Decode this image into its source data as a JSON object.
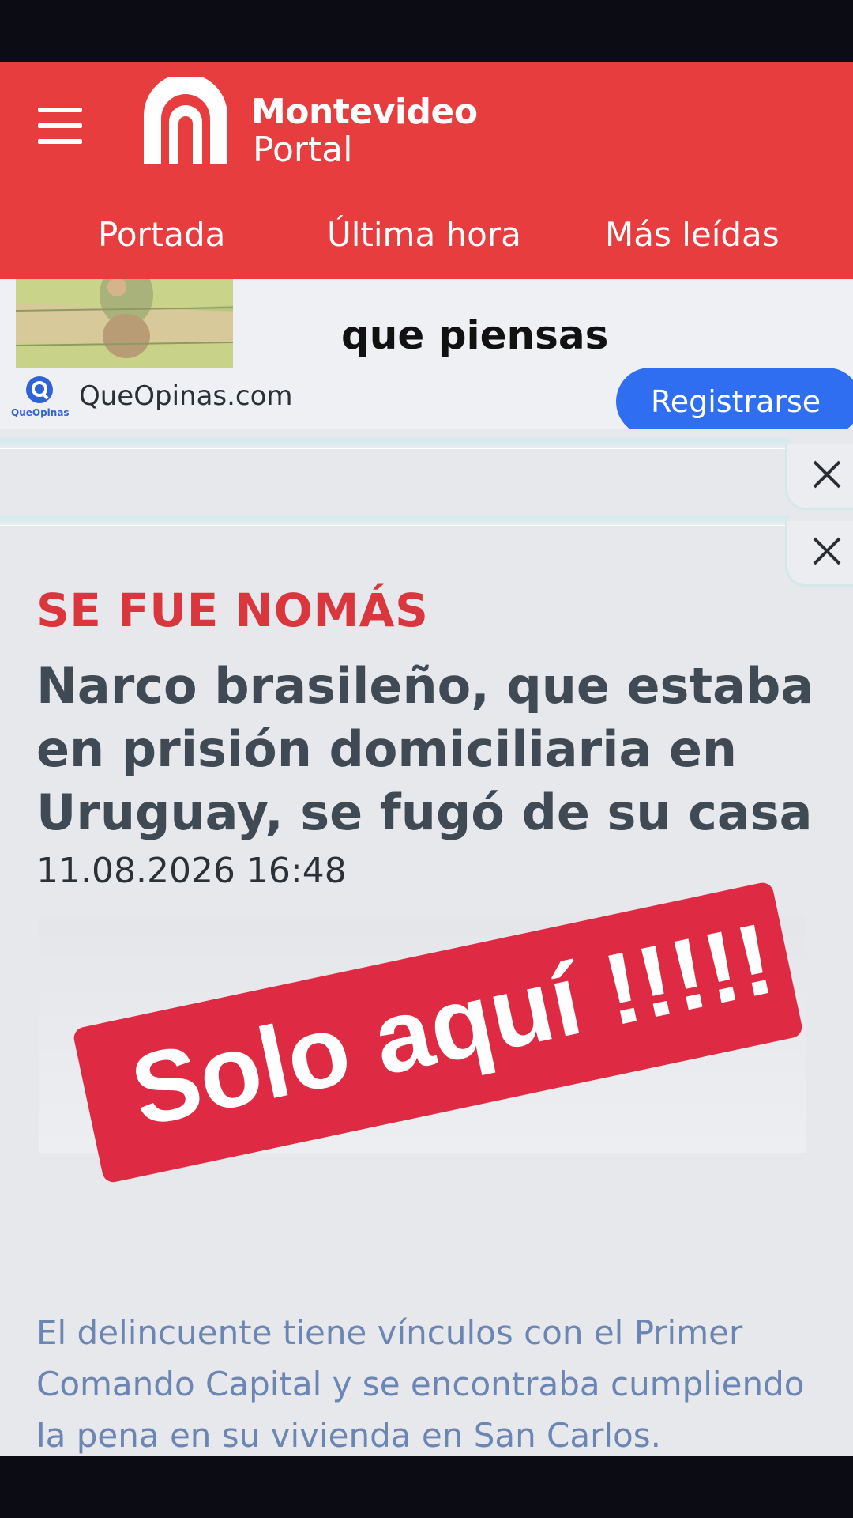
{
  "header": {
    "brand_line1": "Montevideo",
    "brand_line2": "Portal",
    "tabs": [
      {
        "label": "Portada"
      },
      {
        "label": "Última hora"
      },
      {
        "label": "Más leídas"
      }
    ],
    "accent_color": "#e83d3f"
  },
  "ad": {
    "headline": "que piensas",
    "advertiser_logo_text": "QueOpinas",
    "site": "QueOpinas.com",
    "cta_label": "Registrarse",
    "cta_color": "#2f6ef0"
  },
  "article": {
    "kicker": "SE FUE NOMÁS",
    "headline": "Narco brasileño, que estaba en prisión domiciliaria en Uruguay, se fugó de su casa",
    "timestamp": "11.08.2026 16:48",
    "summary": "El delincuente tiene vínculos con el Primer Comando Capital y se encontraba cumpliendo la pena en su vivienda en San Carlos."
  },
  "overlay": {
    "stamp_text": "Solo aquí !!!!!",
    "stamp_color": "#de2b43"
  }
}
